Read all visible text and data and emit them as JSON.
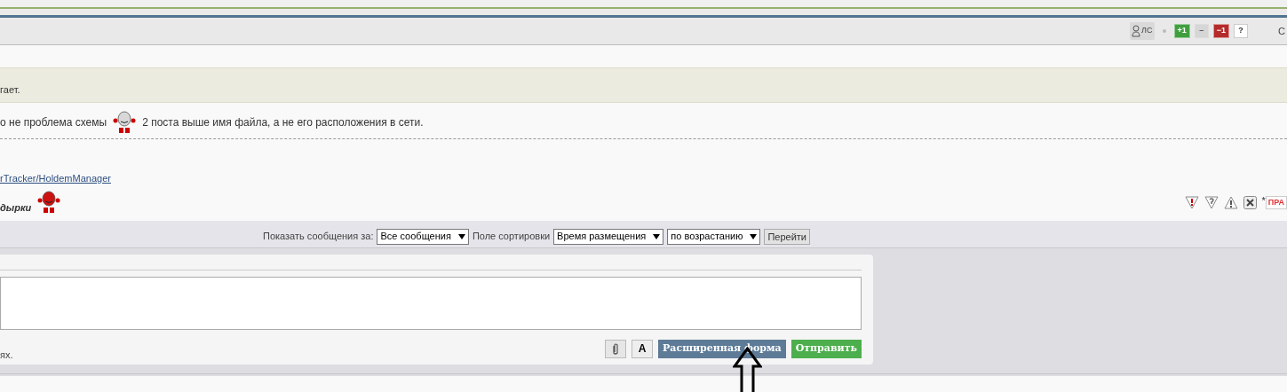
{
  "header": {
    "pm_label": "ЛС",
    "votes": [
      {
        "kind": "plus",
        "label": "+1"
      },
      {
        "kind": "neutral",
        "label": "–"
      },
      {
        "kind": "minus",
        "label": "−1"
      },
      {
        "kind": "help",
        "label": "?"
      }
    ],
    "cut_text": "С"
  },
  "quote": {
    "text": "гает."
  },
  "post": {
    "before_smiley": "о не проблема схемы",
    "after_smiley": "2 поста выше имя файла, а не его расположения в сети.",
    "link": "rTracker/HoldemManager",
    "signature": "дырки"
  },
  "post_actions": [
    {
      "kind": "report"
    },
    {
      "kind": "question"
    },
    {
      "kind": "warning"
    },
    {
      "kind": "delete"
    }
  ],
  "post_badge": {
    "mark": "*",
    "label": "ПРА"
  },
  "sort_bar": {
    "show_label": "Показать сообщения за:",
    "show_value": "Все сообщения",
    "sort_label": "Поле сортировки",
    "sort_value": "Время размещения",
    "order_value": "по возрастанию",
    "go_button": "Перейти"
  },
  "reply": {
    "hint": "ях.",
    "font_button": "A",
    "advanced_button": "Расширенная форма",
    "send_button": "Отправить"
  }
}
